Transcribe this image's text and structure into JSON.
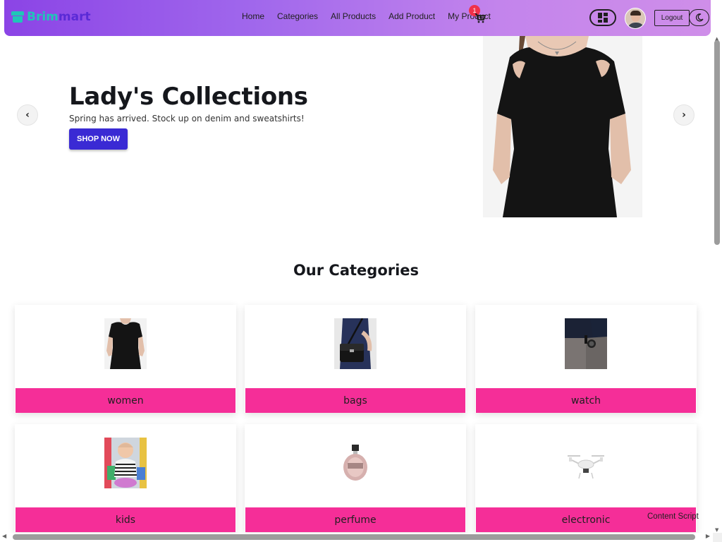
{
  "brand": {
    "part1": "Brim",
    "part2": "mart",
    "color1": "#1fc6b8",
    "color2": "#5a2ad6"
  },
  "nav": {
    "links": [
      "Home",
      "Categories",
      "All Products",
      "Add Product",
      "My Product"
    ],
    "cart_count": "1",
    "logout_label": "Logout",
    "dashboard_icon": "grid-icon",
    "theme_icon": "moon-icon"
  },
  "hero": {
    "title": "Lady's Collections",
    "subtitle": "Spring has arrived. Stock up on denim and sweatshirts!",
    "cta_label": "SHOP NOW",
    "prev_glyph": "‹",
    "next_glyph": "›"
  },
  "categories": {
    "heading": "Our Categories",
    "items": [
      {
        "label": "women"
      },
      {
        "label": "bags"
      },
      {
        "label": "watch"
      },
      {
        "label": "kids"
      },
      {
        "label": "perfume"
      },
      {
        "label": "electronic"
      }
    ]
  },
  "overlay": {
    "content_script": "Content Script"
  },
  "colors": {
    "accent": "#3a2ad4",
    "category_bar": "#f52e98",
    "navbar_start": "#8b44e6",
    "navbar_end": "#cf8ee9",
    "badge": "#f0314a"
  }
}
